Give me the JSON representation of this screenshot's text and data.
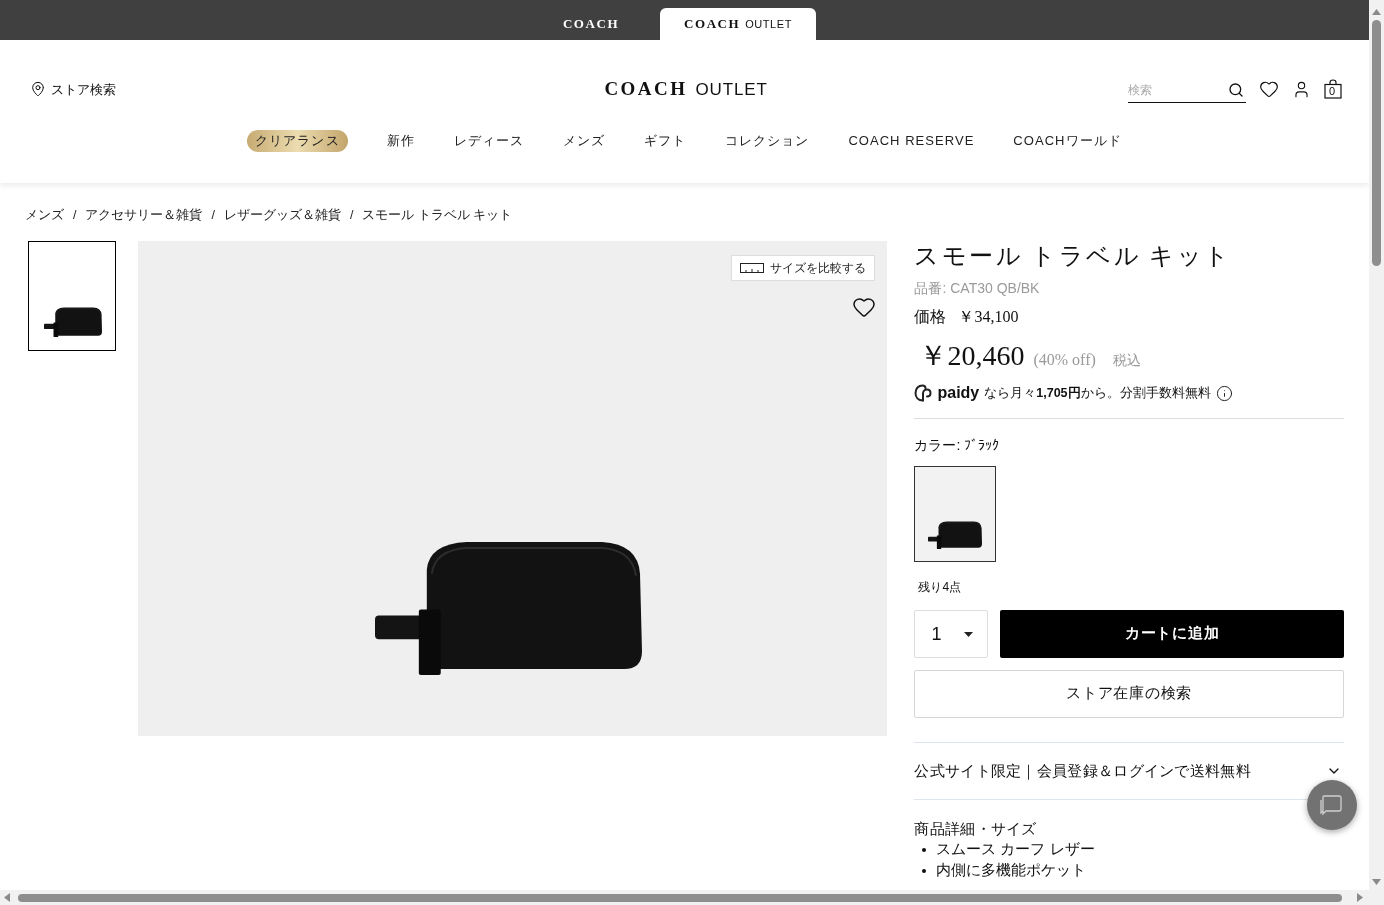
{
  "brand_tabs": [
    {
      "logo": "COACH",
      "selected": false
    },
    {
      "logo": "COACH",
      "suffix": "OUTLET",
      "selected": true
    }
  ],
  "header": {
    "store_search": "ストア検索",
    "logo": {
      "word": "COACH",
      "suffix": "OUTLET"
    },
    "search": {
      "placeholder": "検索"
    },
    "cart_count": "0"
  },
  "nav": [
    {
      "label": "クリアランス",
      "kind": "pill"
    },
    {
      "label": "新作",
      "kind": "link"
    },
    {
      "label": "レディース",
      "kind": "link"
    },
    {
      "label": "メンズ",
      "kind": "link"
    },
    {
      "label": "ギフト",
      "kind": "link"
    },
    {
      "label": "コレクション",
      "kind": "link"
    },
    {
      "label": "COACH RESERVE",
      "kind": "link"
    },
    {
      "label": "COACHワールド",
      "kind": "link"
    }
  ],
  "breadcrumb": {
    "separator": "/",
    "items": [
      "メンズ",
      "アクセサリー＆雑貨",
      "レザーグッズ＆雑貨",
      "スモール トラベル キット"
    ]
  },
  "gallery": {
    "thumbnails": [
      {
        "selected": true
      }
    ],
    "compare_button": "サイズを比較する"
  },
  "product": {
    "title": "スモール トラベル キット",
    "sku": "品番: CAT30 QB/BK",
    "list_price_label": "価格",
    "list_price": "￥34,100",
    "sale_price": "￥20,460",
    "discount": "(40% off)",
    "tax_note": "税込",
    "paidy": {
      "brand": "paidy",
      "text": "なら月々**1,705円**から。分割手数料無料"
    },
    "color_label": "カラー: ﾌﾞﾗｯｸ",
    "swatches": [
      {
        "selected": true
      }
    ],
    "stock": "残り4点",
    "quantity": "1",
    "add_to_cart": "カートに追加",
    "store_stock": "ストア在庫の検索"
  },
  "accordions": [
    {
      "title": "公式サイト限定｜会員登録＆ログインで送料無料",
      "expanded": false
    },
    {
      "title": "商品詳細・サイズ",
      "expanded": true,
      "bullets": [
        "スムース カーフ レザー",
        "内側に多機能ポケット"
      ]
    }
  ]
}
